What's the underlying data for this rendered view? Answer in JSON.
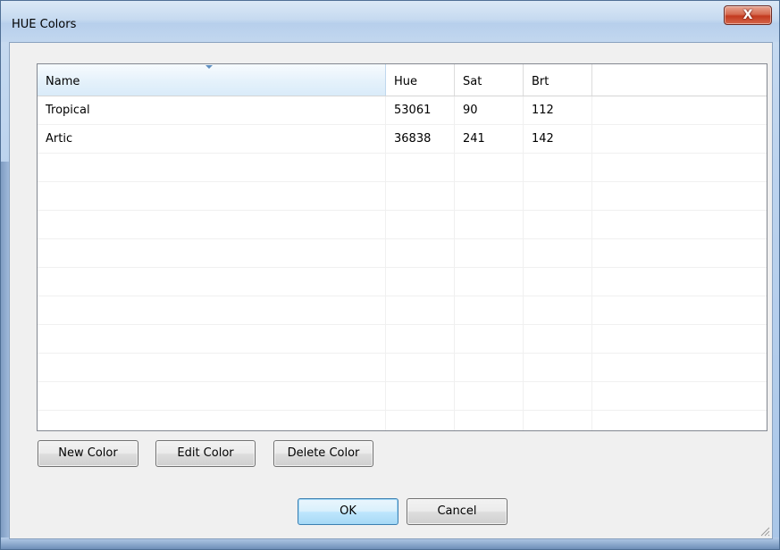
{
  "window": {
    "title": "HUE Colors",
    "close_glyph": "X"
  },
  "list": {
    "columns": [
      "Name",
      "Hue",
      "Sat",
      "Brt"
    ],
    "sorted_column": "Name",
    "rows": [
      {
        "name": "Tropical",
        "hue": "53061",
        "sat": "90",
        "brt": "112"
      },
      {
        "name": "Artic",
        "hue": "36838",
        "sat": "241",
        "brt": "142"
      }
    ]
  },
  "actions": {
    "new_label": "New Color",
    "edit_label": "Edit Color",
    "delete_label": "Delete Color"
  },
  "dialog": {
    "ok_label": "OK",
    "cancel_label": "Cancel"
  },
  "icons": {
    "close": "close-icon",
    "sort": "sort-descending-icon",
    "grip": "resize-grip-icon"
  },
  "colors": {
    "close_button": "#c33a1f",
    "default_button_border": "#3c7fb1",
    "sorted_header": "#d9ebf9"
  }
}
